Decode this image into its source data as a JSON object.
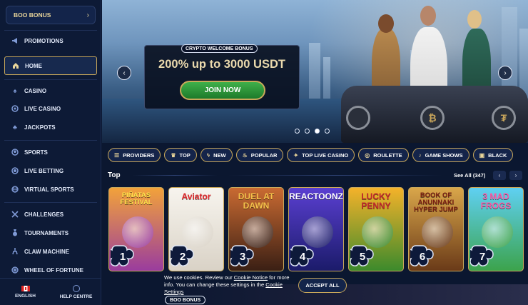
{
  "sidebar": {
    "boo_bonus": "BOO BONUS",
    "items": [
      {
        "label": "PROMOTIONS",
        "icon": "megaphone-icon"
      },
      {
        "label": "HOME",
        "icon": "home-icon",
        "active": true
      },
      {
        "label": "CASINO",
        "icon": "spade-icon"
      },
      {
        "label": "LIVE CASINO",
        "icon": "chip-icon"
      },
      {
        "label": "JACKPOTS",
        "icon": "clover-icon"
      },
      {
        "label": "SPORTS",
        "icon": "ball-icon"
      },
      {
        "label": "LIVE BETTING",
        "icon": "live-icon"
      },
      {
        "label": "VIRTUAL SPORTS",
        "icon": "globe-icon"
      },
      {
        "label": "CHALLENGES",
        "icon": "swords-icon"
      },
      {
        "label": "TOURNAMENTS",
        "icon": "medal-icon"
      },
      {
        "label": "CLAW MACHINE",
        "icon": "claw-icon"
      },
      {
        "label": "WHEEL OF FORTUNE",
        "icon": "wheel-icon"
      }
    ],
    "footer": {
      "language": "ENGLISH",
      "help": "HELP CENTRE"
    }
  },
  "hero": {
    "tag": "CRYPTO WELCOME BONUS",
    "headline": "200% up to 3000 USDT",
    "cta": "JOIN NOW",
    "slides": 4,
    "active_slide": 3
  },
  "categories": [
    {
      "label": "PROVIDERS",
      "icon": "list-icon"
    },
    {
      "label": "TOP",
      "icon": "crown-icon"
    },
    {
      "label": "NEW",
      "icon": "lightning-icon"
    },
    {
      "label": "POPULAR",
      "icon": "fire-icon"
    },
    {
      "label": "TOP LIVE CASINO",
      "icon": "star-icon"
    },
    {
      "label": "ROULETTE",
      "icon": "roulette-icon"
    },
    {
      "label": "GAME SHOWS",
      "icon": "mic-icon"
    },
    {
      "label": "BLACK",
      "icon": "cards-icon"
    }
  ],
  "top": {
    "title": "Top",
    "see_all": "See All (347)",
    "games": [
      {
        "rank": "1",
        "title": "PIÑATAS FESTIVAL",
        "bg1": "#f2a23a",
        "bg2": "#9a3c9e",
        "fg": "#ffe14a"
      },
      {
        "rank": "2",
        "title": "Aviator",
        "bg1": "#f7f4ee",
        "bg2": "#d9d2c6",
        "fg": "#e2262a"
      },
      {
        "rank": "3",
        "title": "DUEL AT DAWN",
        "bg1": "#c96a32",
        "bg2": "#3a1f14",
        "fg": "#f3c04a"
      },
      {
        "rank": "4",
        "title": "REACTOONZ",
        "bg1": "#5a3fd1",
        "bg2": "#1b1b6a",
        "fg": "#ffffff"
      },
      {
        "rank": "5",
        "title": "LUCKY PENNY",
        "bg1": "#f4b22a",
        "bg2": "#3c8a2c",
        "fg": "#c2272d"
      },
      {
        "rank": "6",
        "title": "BOOK OF ANUNNAKI HYPER JUMP",
        "bg1": "#d9a64a",
        "bg2": "#6a3a18",
        "fg": "#7a1f12"
      },
      {
        "rank": "7",
        "title": "3 MAD FROGS",
        "bg1": "#5fd0f2",
        "bg2": "#3ca34c",
        "fg": "#ff5aa8"
      }
    ]
  },
  "cookie": {
    "text_1": "We use cookies. Review our ",
    "link_1": "Cookie Notice",
    "text_2": " for more info. You can change these settings in the ",
    "link_2": "Cookie Settings",
    "accept": "ACCEPT ALL"
  },
  "promo_strip": {
    "tag": "BOO BONUS"
  }
}
